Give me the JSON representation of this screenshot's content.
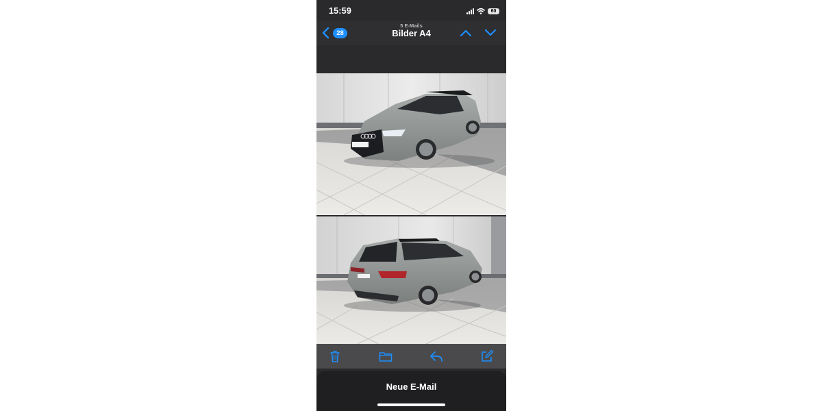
{
  "status_bar": {
    "time": "15:59",
    "battery": "60"
  },
  "header": {
    "back_count": "28",
    "subtitle": "5 E-Mails",
    "title": "Bilder A4",
    "icons": {
      "back": "chevron-left-icon",
      "previous": "chevron-up-icon",
      "next": "chevron-down-icon"
    }
  },
  "attachments": [
    {
      "name": "car-front-photo"
    },
    {
      "name": "car-rear-photo"
    }
  ],
  "toolbar": {
    "icons": [
      "trash-icon",
      "folder-icon",
      "reply-icon",
      "compose-icon"
    ],
    "accent": "#1d8fff"
  },
  "bottom_bar": {
    "label": "Neue E-Mail"
  },
  "colors": {
    "background": "#2a2a2c",
    "accent": "#1d8fff",
    "text": "#ffffff"
  }
}
